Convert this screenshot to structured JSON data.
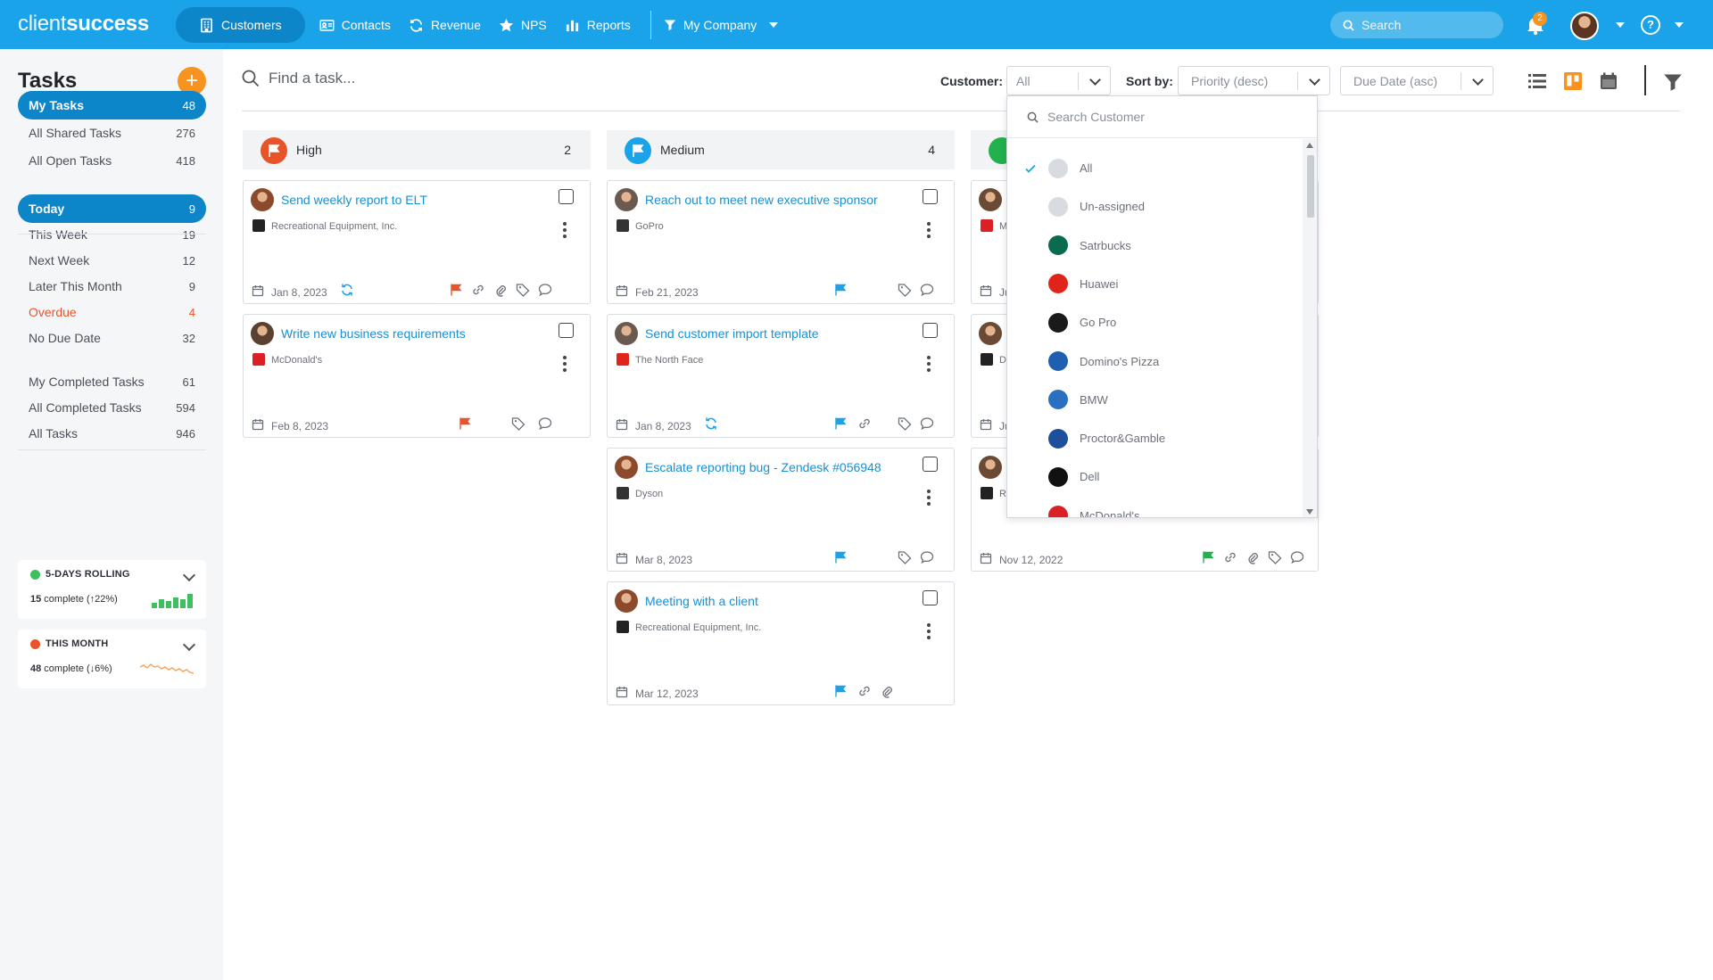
{
  "app": {
    "logo_client": "client",
    "logo_success": "success"
  },
  "nav": {
    "items": [
      {
        "label": "Customers",
        "icon": "building-icon"
      },
      {
        "label": "Contacts",
        "icon": "contact-card-icon"
      },
      {
        "label": "Revenue",
        "icon": "refresh-icon"
      },
      {
        "label": "NPS",
        "icon": "star-icon"
      },
      {
        "label": "Reports",
        "icon": "bar-chart-icon"
      }
    ],
    "company": "My Company",
    "search_placeholder": "Search",
    "notification_count": "2",
    "help": "?"
  },
  "sidebar": {
    "title": "Tasks",
    "add": "+",
    "groups": [
      [
        {
          "label": "My  Tasks",
          "count": "48",
          "active": true
        },
        {
          "label": "All Shared Tasks",
          "count": "276"
        },
        {
          "label": "All Open Tasks",
          "count": "418"
        }
      ],
      [
        {
          "label": "Today",
          "count": "9",
          "active": true
        },
        {
          "label": "This Week",
          "count": "19"
        },
        {
          "label": "Next Week",
          "count": "12"
        },
        {
          "label": "Later This Month",
          "count": "9"
        },
        {
          "label": "Overdue",
          "count": "4",
          "overdue": true
        },
        {
          "label": "No Due Date",
          "count": "32"
        }
      ],
      [
        {
          "label": "My Completed Tasks",
          "count": "61"
        },
        {
          "label": "All Completed Tasks",
          "count": "594"
        },
        {
          "label": "All Tasks",
          "count": "946"
        }
      ]
    ],
    "stats": [
      {
        "title": "5-DAYS ROLLING",
        "count": "15",
        "text": " complete (↑22%)",
        "color": "#3fbf5f"
      },
      {
        "title": "THIS MONTH",
        "count": "48",
        "text": " complete (↓6%)",
        "color": "#e8542a"
      }
    ]
  },
  "toolbar": {
    "find_placeholder": "Find a task...",
    "customer_label": "Customer:",
    "customer_value": "All",
    "sort_label": "Sort by:",
    "sort_value": "Priority (desc)",
    "sort2_value": "Due Date (asc)"
  },
  "columns": [
    {
      "title": "High",
      "count": "2",
      "color": "#e8542a"
    },
    {
      "title": "Medium",
      "count": "4",
      "color": "#1aa3e8"
    }
  ],
  "cards": {
    "high": [
      {
        "title": "Send weekly report to ELT",
        "company": "Recreational Equipment, Inc.",
        "date": "Jan 8, 2023"
      },
      {
        "title": "Write new business requirements",
        "company": "McDonald's",
        "date": "Feb 8, 2023"
      }
    ],
    "medium": [
      {
        "title": "Reach out to meet new executive sponsor",
        "company": "GoPro",
        "date": "Feb 21, 2023"
      },
      {
        "title": "Send customer import template",
        "company": "The North Face",
        "date": "Jan 8, 2023"
      },
      {
        "title": "Escalate reporting bug - Zendesk #056948",
        "company": "Dyson",
        "date": "Mar 8, 2023"
      },
      {
        "title": "Meeting with a client",
        "company": "Recreational Equipment, Inc.",
        "date": "Mar 12, 2023"
      }
    ],
    "low_partial": [
      {
        "company_initial": "M",
        "date": "Ju"
      },
      {
        "company_initial": "D",
        "date": "Ju"
      },
      {
        "company_initial": "R",
        "date": "Nov 12, 2022"
      }
    ]
  },
  "dropdown": {
    "search_placeholder": "Search Customer",
    "items": [
      {
        "name": "All",
        "selected": true,
        "color": "#d8dbe0"
      },
      {
        "name": "Un-assigned",
        "color": "#d8dbe0"
      },
      {
        "name": "Satrbucks",
        "color": "#0b6b4f"
      },
      {
        "name": "Huawei",
        "color": "#e0241c"
      },
      {
        "name": "Go Pro",
        "color": "#1a1a1a"
      },
      {
        "name": "Domino's Pizza",
        "color": "#1f5fb0"
      },
      {
        "name": "BMW",
        "color": "#2b6fc1"
      },
      {
        "name": "Proctor&Gamble",
        "color": "#1e4f9c"
      },
      {
        "name": "Dell",
        "color": "#111111"
      },
      {
        "name": "McDonald's",
        "color": "#da1f26"
      }
    ]
  }
}
